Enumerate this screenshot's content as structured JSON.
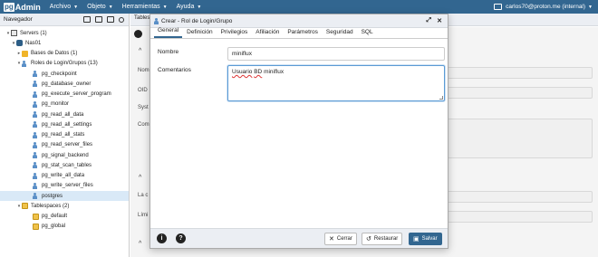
{
  "app": {
    "logo_pg": "pg",
    "logo_admin": "Admin",
    "menu": [
      {
        "label": "Archivo"
      },
      {
        "label": "Objeto"
      },
      {
        "label": "Herramientas"
      },
      {
        "label": "Ayuda"
      }
    ],
    "user": "carlos70@proton.me (internal)"
  },
  "navigator": {
    "title": "Navegador",
    "tree": [
      {
        "label": "Servers (1)",
        "icon": "server-icon",
        "toggle": "▾"
      },
      {
        "label": "Nas01",
        "icon": "postgres-elephant-icon",
        "toggle": "▾"
      },
      {
        "label": "Bases de Datos (1)",
        "icon": "database-icon",
        "toggle": "▸"
      },
      {
        "label": "Roles de Login/Grupos (13)",
        "icon": "roles-icon",
        "toggle": "▾"
      },
      {
        "label": "pg_checkpoint",
        "icon": "role-icon",
        "toggle": ""
      },
      {
        "label": "pg_database_owner",
        "icon": "role-icon",
        "toggle": ""
      },
      {
        "label": "pg_execute_server_program",
        "icon": "role-icon",
        "toggle": ""
      },
      {
        "label": "pg_monitor",
        "icon": "role-icon",
        "toggle": ""
      },
      {
        "label": "pg_read_all_data",
        "icon": "role-icon",
        "toggle": ""
      },
      {
        "label": "pg_read_all_settings",
        "icon": "role-icon",
        "toggle": ""
      },
      {
        "label": "pg_read_all_stats",
        "icon": "role-icon",
        "toggle": ""
      },
      {
        "label": "pg_read_server_files",
        "icon": "role-icon",
        "toggle": ""
      },
      {
        "label": "pg_signal_backend",
        "icon": "role-icon",
        "toggle": ""
      },
      {
        "label": "pg_stat_scan_tables",
        "icon": "role-icon",
        "toggle": ""
      },
      {
        "label": "pg_write_all_data",
        "icon": "role-icon",
        "toggle": ""
      },
      {
        "label": "pg_write_server_files",
        "icon": "role-icon",
        "toggle": ""
      },
      {
        "label": "postgres",
        "icon": "role-icon",
        "toggle": "",
        "selected": true
      },
      {
        "label": "Tablespaces (2)",
        "icon": "tablespace-icon",
        "toggle": "▾"
      },
      {
        "label": "pg_default",
        "icon": "tablespace-icon",
        "toggle": ""
      },
      {
        "label": "pg_global",
        "icon": "tablespace-icon",
        "toggle": ""
      }
    ]
  },
  "background_panel": {
    "tab_label": "Tables",
    "labels": [
      "Nom",
      "OID",
      "Syst",
      "Com",
      "La c",
      "Lími"
    ]
  },
  "dialog": {
    "title": "Crear - Rol de Login/Grupo",
    "tabs": [
      "General",
      "Definición",
      "Privilegios",
      "Afiliación",
      "Parámetros",
      "Seguridad",
      "SQL"
    ],
    "active_tab": "General",
    "fields": {
      "name_label": "Nombre",
      "name_value": "miniflux",
      "comments_label": "Comentarios",
      "comments_word1": "Usuario",
      "comments_word2": "BD",
      "comments_rest": "miniflux"
    },
    "footer": {
      "info_label": "i",
      "help_label": "?",
      "close_label": "Cerrar",
      "restore_label": "Restaurar",
      "save_label": "Salvar"
    }
  },
  "colors": {
    "brand": "#326690",
    "selected_row": "#d9e9f7"
  }
}
